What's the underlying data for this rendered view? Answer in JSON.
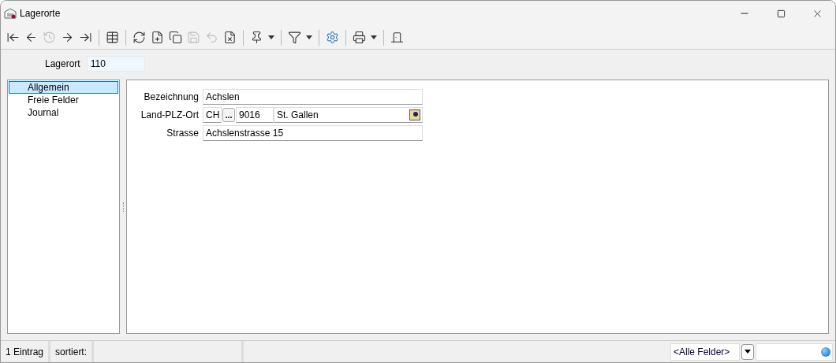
{
  "window": {
    "title": "Lagerorte"
  },
  "toolbar": [
    {
      "kind": "first",
      "disabled": false
    },
    {
      "kind": "prev",
      "disabled": false
    },
    {
      "kind": "history",
      "disabled": true
    },
    {
      "kind": "next",
      "disabled": false
    },
    {
      "kind": "last",
      "disabled": false
    },
    {
      "kind": "sep"
    },
    {
      "kind": "table",
      "disabled": false
    },
    {
      "kind": "sep"
    },
    {
      "kind": "refresh",
      "disabled": false
    },
    {
      "kind": "new",
      "disabled": false
    },
    {
      "kind": "copy",
      "disabled": false
    },
    {
      "kind": "save",
      "disabled": true
    },
    {
      "kind": "undo",
      "disabled": true
    },
    {
      "kind": "delete",
      "disabled": false
    },
    {
      "kind": "sep"
    },
    {
      "kind": "pin",
      "disabled": false
    },
    {
      "kind": "caret",
      "disabled": false
    },
    {
      "kind": "sep"
    },
    {
      "kind": "filter",
      "disabled": false
    },
    {
      "kind": "caret",
      "disabled": false
    },
    {
      "kind": "sep"
    },
    {
      "kind": "settings",
      "disabled": false
    },
    {
      "kind": "sep"
    },
    {
      "kind": "print",
      "disabled": false
    },
    {
      "kind": "caret",
      "disabled": false
    },
    {
      "kind": "sep"
    },
    {
      "kind": "exit",
      "disabled": false
    }
  ],
  "header": {
    "label": "Lagerort",
    "value": "110"
  },
  "sidebar": {
    "items": [
      {
        "label": "Allgemein",
        "selected": true
      },
      {
        "label": "Freie Felder",
        "selected": false
      },
      {
        "label": "Journal",
        "selected": false
      }
    ]
  },
  "form": {
    "bezeichnung": {
      "label": "Bezeichnung",
      "value": "Achslen"
    },
    "land_plz_ort": {
      "label": "Land-PLZ-Ort",
      "land": "CH",
      "lookup": "...",
      "plz": "9016",
      "ort": "St. Gallen"
    },
    "strasse": {
      "label": "Strasse",
      "value": "Achslenstrasse 15"
    }
  },
  "status_bar": {
    "count": "1 Eintrag",
    "sort": "sortiert:",
    "field_select": "<Alle Felder>"
  }
}
